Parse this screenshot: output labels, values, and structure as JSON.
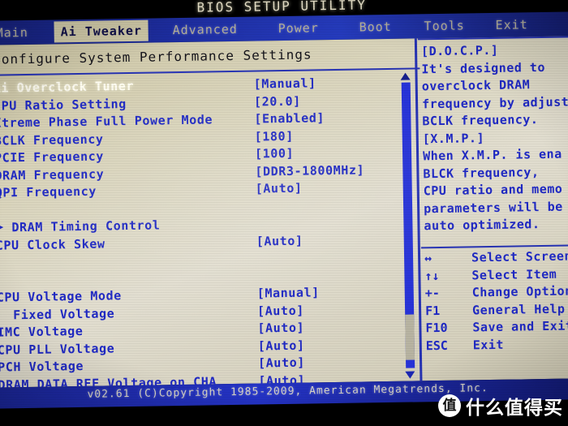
{
  "window": {
    "title": "BIOS SETUP UTILITY",
    "footer": "v02.61  (C)Copyright 1985-2009, American Megatrends, Inc."
  },
  "tabs": [
    {
      "label": "Main",
      "active": false
    },
    {
      "label": "Ai Tweaker",
      "active": true
    },
    {
      "label": "Advanced",
      "active": false
    },
    {
      "label": "Power",
      "active": false
    },
    {
      "label": "Boot",
      "active": false
    },
    {
      "label": "Tools",
      "active": false
    },
    {
      "label": "Exit",
      "active": false
    }
  ],
  "main": {
    "section_header": "Configure System Performance Settings",
    "rows": [
      {
        "label": "Ai Overclock Tuner",
        "value": "[Manual]",
        "selected": true
      },
      {
        "label": "CPU Ratio Setting",
        "value": "[20.0]"
      },
      {
        "label": "Xtreme Phase Full Power Mode",
        "value": "[Enabled]"
      },
      {
        "label": "BCLK Frequency",
        "value": "[180]"
      },
      {
        "label": "PCIE Frequency",
        "value": "[100]"
      },
      {
        "label": "DRAM Frequency",
        "value": "[DDR3-1800MHz]"
      },
      {
        "label": "QPI Frequency",
        "value": "[Auto]"
      },
      {
        "label": "",
        "value": "",
        "spacer": true
      },
      {
        "label": "DRAM Timing Control",
        "value": "",
        "submenu": true
      },
      {
        "label": "CPU Clock Skew",
        "value": "[Auto]"
      },
      {
        "label": "",
        "value": "",
        "spacer": true
      },
      {
        "label": "",
        "value": "",
        "spacer": true
      },
      {
        "label": "CPU Voltage Mode",
        "value": "[Manual]"
      },
      {
        "label": "Fixed Voltage",
        "value": "[Auto]",
        "indent": true
      },
      {
        "label": "IMC Voltage",
        "value": "[Auto]"
      },
      {
        "label": "CPU PLL Voltage",
        "value": "[Auto]"
      },
      {
        "label": "PCH Voltage",
        "value": "[Auto]"
      },
      {
        "label": "DRAM DATA REF Voltage on CHA",
        "value": "[Auto]"
      }
    ]
  },
  "help": {
    "lines": [
      "[D.O.C.P.]",
      "It's designed to",
      "overclock DRAM",
      "frequency by adjust",
      "BCLK frequency.",
      "[X.M.P.]",
      "When X.M.P. is ena",
      "BLCK frequency,",
      "CPU ratio and memo",
      "parameters will be",
      "auto optimized."
    ]
  },
  "keys": [
    {
      "key": "↔",
      "desc": "Select Screen"
    },
    {
      "key": "↑↓",
      "desc": "Select Item"
    },
    {
      "key": "+-",
      "desc": "Change Option"
    },
    {
      "key": "F1",
      "desc": "General Help"
    },
    {
      "key": "F10",
      "desc": "Save and Exit"
    },
    {
      "key": "ESC",
      "desc": "Exit"
    }
  ],
  "watermark": {
    "badge": "值",
    "text": "什么值得买"
  },
  "colors": {
    "panel_bg": "#d9d4bb",
    "text_blue": "#1f29c4",
    "bar_blue": "#2433c6",
    "selected_text": "#fffdf2"
  }
}
